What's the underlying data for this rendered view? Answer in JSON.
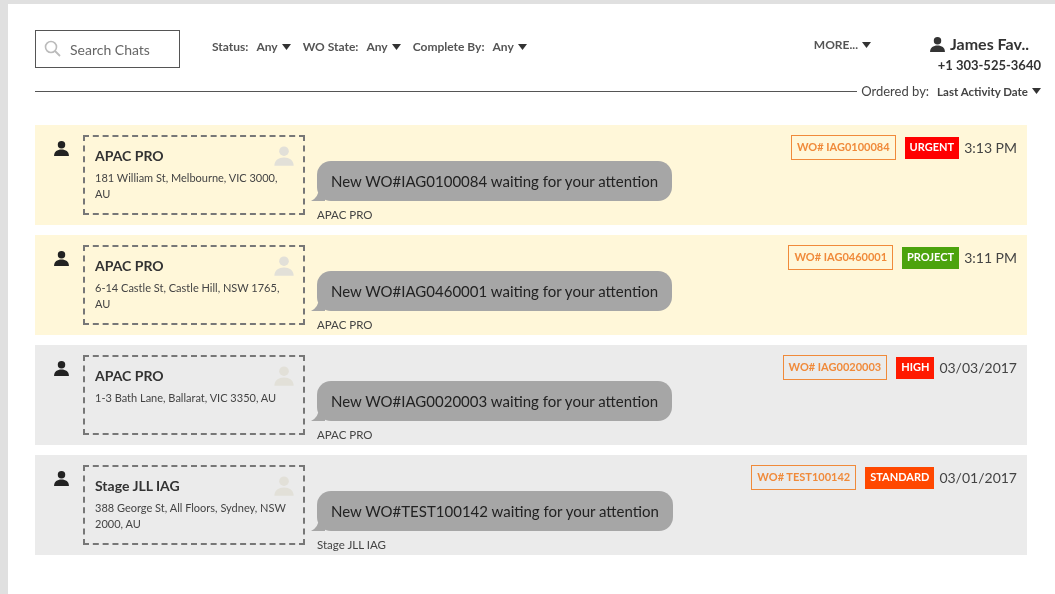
{
  "search": {
    "placeholder": "Search Chats"
  },
  "filters": [
    {
      "label": "Status:",
      "value": "Any"
    },
    {
      "label": "WO State:",
      "value": "Any"
    },
    {
      "label": "Complete By:",
      "value": "Any"
    }
  ],
  "more_menu": "MORE...",
  "user": {
    "name": "James Fav..",
    "phone": "+1 303-525-3640"
  },
  "ordering": {
    "label": "Ordered by:",
    "value": "Last Activity Date"
  },
  "chats": [
    {
      "unread": true,
      "company": "APAC PRO",
      "address": "181 William St, Melbourne, VIC 3000, AU",
      "message": "New WO#IAG0100084 waiting for your attention",
      "sender": "APAC PRO",
      "work_order": "WO# IAG0100084",
      "priority": "URGENT",
      "color": "#ff0000",
      "time": "3:13 PM"
    },
    {
      "unread": true,
      "company": "APAC PRO",
      "address": "6-14 Castle St, Castle Hill, NSW 1765, AU",
      "message": "New WO#IAG0460001 waiting for your attention",
      "sender": "APAC PRO",
      "work_order": "WO# IAG0460001",
      "priority": "PROJECT",
      "color": "#4ca30d",
      "time": "3:11 PM"
    },
    {
      "unread": false,
      "company": "APAC PRO",
      "address": "1-3 Bath Lane, Ballarat, VIC 3350, AU",
      "message": "New WO#IAG0020003 waiting for your attention",
      "sender": "APAC PRO",
      "work_order": "WO# IAG0020003",
      "priority": "HIGH",
      "color": "#ff1a00",
      "time": "03/03/2017"
    },
    {
      "unread": false,
      "company": "Stage JLL IAG",
      "address": "388 George St, All Floors, Sydney, NSW 2000, AU",
      "message": "New WO#TEST100142 waiting for your attention",
      "sender": "Stage JLL IAG",
      "work_order": "WO# TEST100142",
      "priority": "STANDARD",
      "color": "#ff4800",
      "time": "03/01/2017"
    }
  ]
}
